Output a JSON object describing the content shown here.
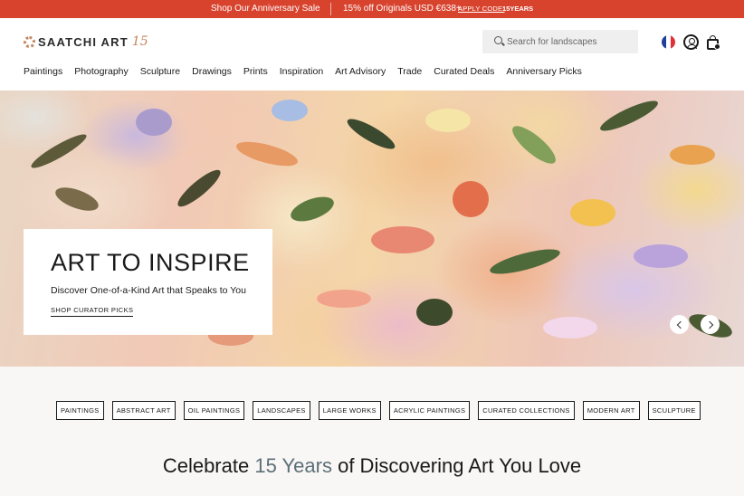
{
  "promo": {
    "sale": "Shop Our Anniversary Sale",
    "offer": "15% off Originals USD €638+",
    "apply_label": "APPLY CODE:",
    "code": "15YEARS",
    "bg_color": "#d8432e"
  },
  "header": {
    "logo_text": "SAATCHI ART",
    "logo_suffix": "15",
    "search_placeholder": "Search for landscapes",
    "icons": [
      "search-icon",
      "france-flag-icon",
      "account-icon",
      "cart-icon"
    ]
  },
  "nav": {
    "items": [
      "Paintings",
      "Photography",
      "Sculpture",
      "Drawings",
      "Prints",
      "Inspiration",
      "Art Advisory",
      "Trade",
      "Curated Deals",
      "Anniversary Picks"
    ]
  },
  "hero": {
    "title": "ART TO INSPIRE",
    "subtitle": "Discover One-of-a-Kind Art that Speaks to You",
    "link": "SHOP CURATOR PICKS"
  },
  "tags": [
    "PAINTINGS",
    "ABSTRACT ART",
    "OIL PAINTINGS",
    "LANDSCAPES",
    "LARGE WORKS",
    "ACRYLIC PAINTINGS",
    "CURATED COLLECTIONS",
    "MODERN ART",
    "SCULPTURE"
  ],
  "headline": {
    "before": "Celebrate ",
    "accent": "15 Years",
    "after": " of Discovering Art You Love",
    "accent_color": "#5c6f78"
  }
}
